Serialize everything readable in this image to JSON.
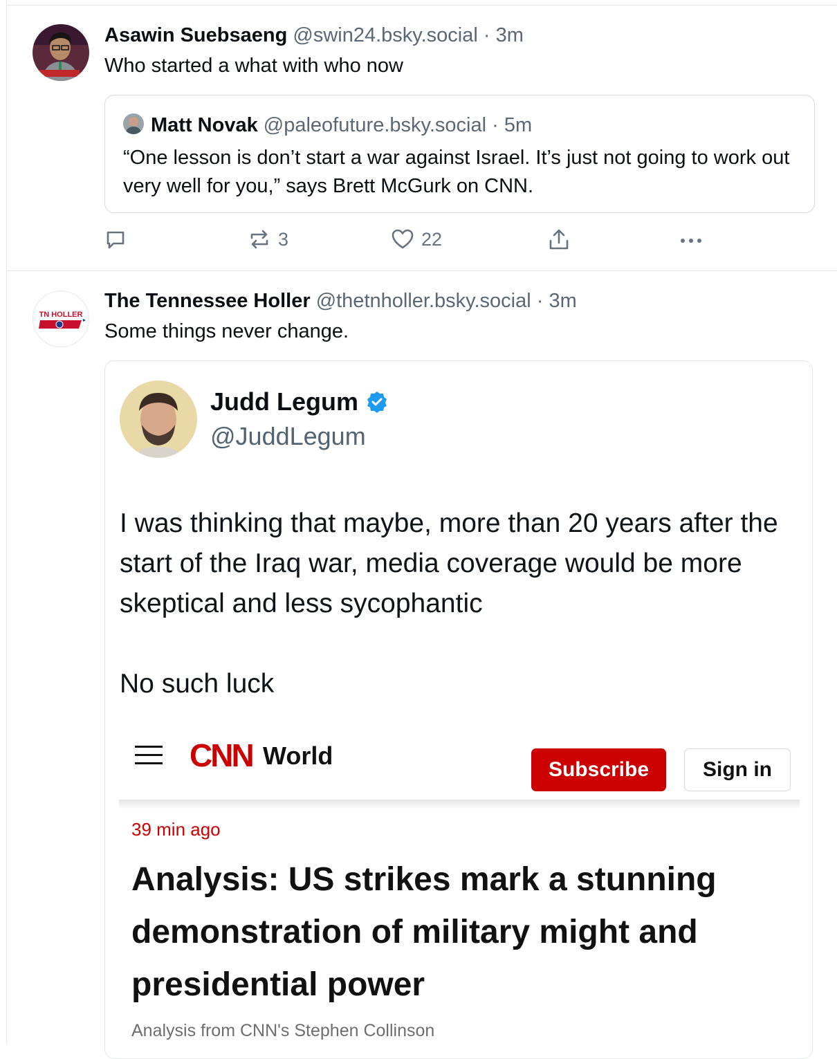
{
  "posts": [
    {
      "author": "Asawin Suebsaeng",
      "handle": "@swin24.bsky.social",
      "separator": "·",
      "time": "3m",
      "text": "Who started a what with who now",
      "quote": {
        "author": "Matt Novak",
        "handle": "@paleofuture.bsky.social",
        "separator": "·",
        "time": "5m",
        "text": "“One lesson is don’t start a war against Israel. It’s just not going to work out very well for you,” says Brett McGurk on CNN."
      },
      "actions": {
        "reply_icon": "reply-icon",
        "repost_icon": "repost-icon",
        "repost_count": "3",
        "like_icon": "heart-icon",
        "like_count": "22",
        "share_icon": "share-icon",
        "more_icon": "more-icon"
      }
    },
    {
      "author": "The Tennessee Holler",
      "handle": "@thetnholler.bsky.social",
      "separator": "·",
      "time": "3m",
      "text": "Some things never change.",
      "avatar_text": "TN HOLLER",
      "embed": {
        "tweet_author": "Judd Legum",
        "tweet_handle": "@JuddLegum",
        "verified_icon": "verified-badge-icon",
        "tweet_text_1": "I was thinking that maybe, more than 20 years after the start of the Iraq war, media coverage would be more skeptical and less sycophantic",
        "tweet_text_2": "No such luck",
        "cnn": {
          "logo": "CNN",
          "section": "World",
          "subscribe": "Subscribe",
          "sign_in": "Sign in",
          "time": "39 min ago",
          "headline": "Analysis: US strikes mark a stunning demonstration of military might and presidential power",
          "byline": "Analysis from CNN's Stephen Collinson"
        }
      }
    }
  ],
  "colors": {
    "border": "#e3e6ea",
    "muted": "#5b6775",
    "cnn_red": "#cc0000",
    "verified_blue": "#1d9bf0"
  }
}
